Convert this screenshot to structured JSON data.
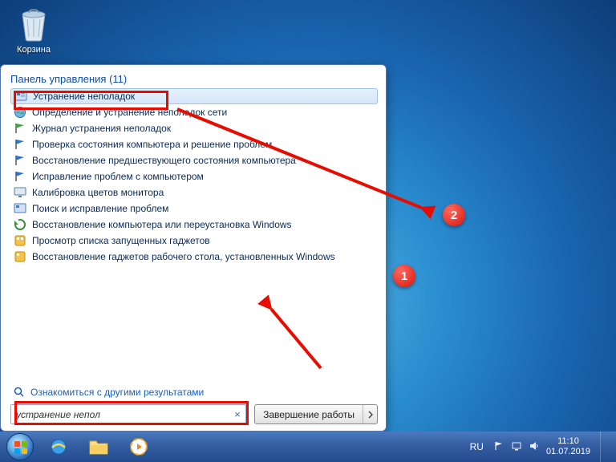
{
  "desktop": {
    "recycle_bin": "Корзина"
  },
  "startmenu": {
    "header_label": "Панель управления",
    "header_count": "(11)",
    "results": [
      "Устранение неполадок",
      "Определение и устранение неполадок сети",
      "Журнал устранения неполадок",
      "Проверка состояния компьютера и решение проблем",
      "Восстановление предшествующего состояния компьютера",
      "Исправление проблем с компьютером",
      "Калибровка цветов монитора",
      "Поиск и исправление проблем",
      "Восстановление компьютера или переустановка Windows",
      "Просмотр списка запущенных гаджетов",
      "Восстановление гаджетов рабочего стола, установленных Windows"
    ],
    "more_results": "Ознакомиться с другими результатами",
    "search_value": "устранение непол",
    "shutdown_label": "Завершение работы"
  },
  "annotations": {
    "step1": "1",
    "step2": "2"
  },
  "taskbar": {
    "lang": "RU",
    "clock_time": "11:10",
    "clock_date": "01.07.2019"
  },
  "icons": {
    "flag_colors": [
      "#f25022",
      "#7fba00",
      "#00a4ef",
      "#ffb900"
    ]
  }
}
